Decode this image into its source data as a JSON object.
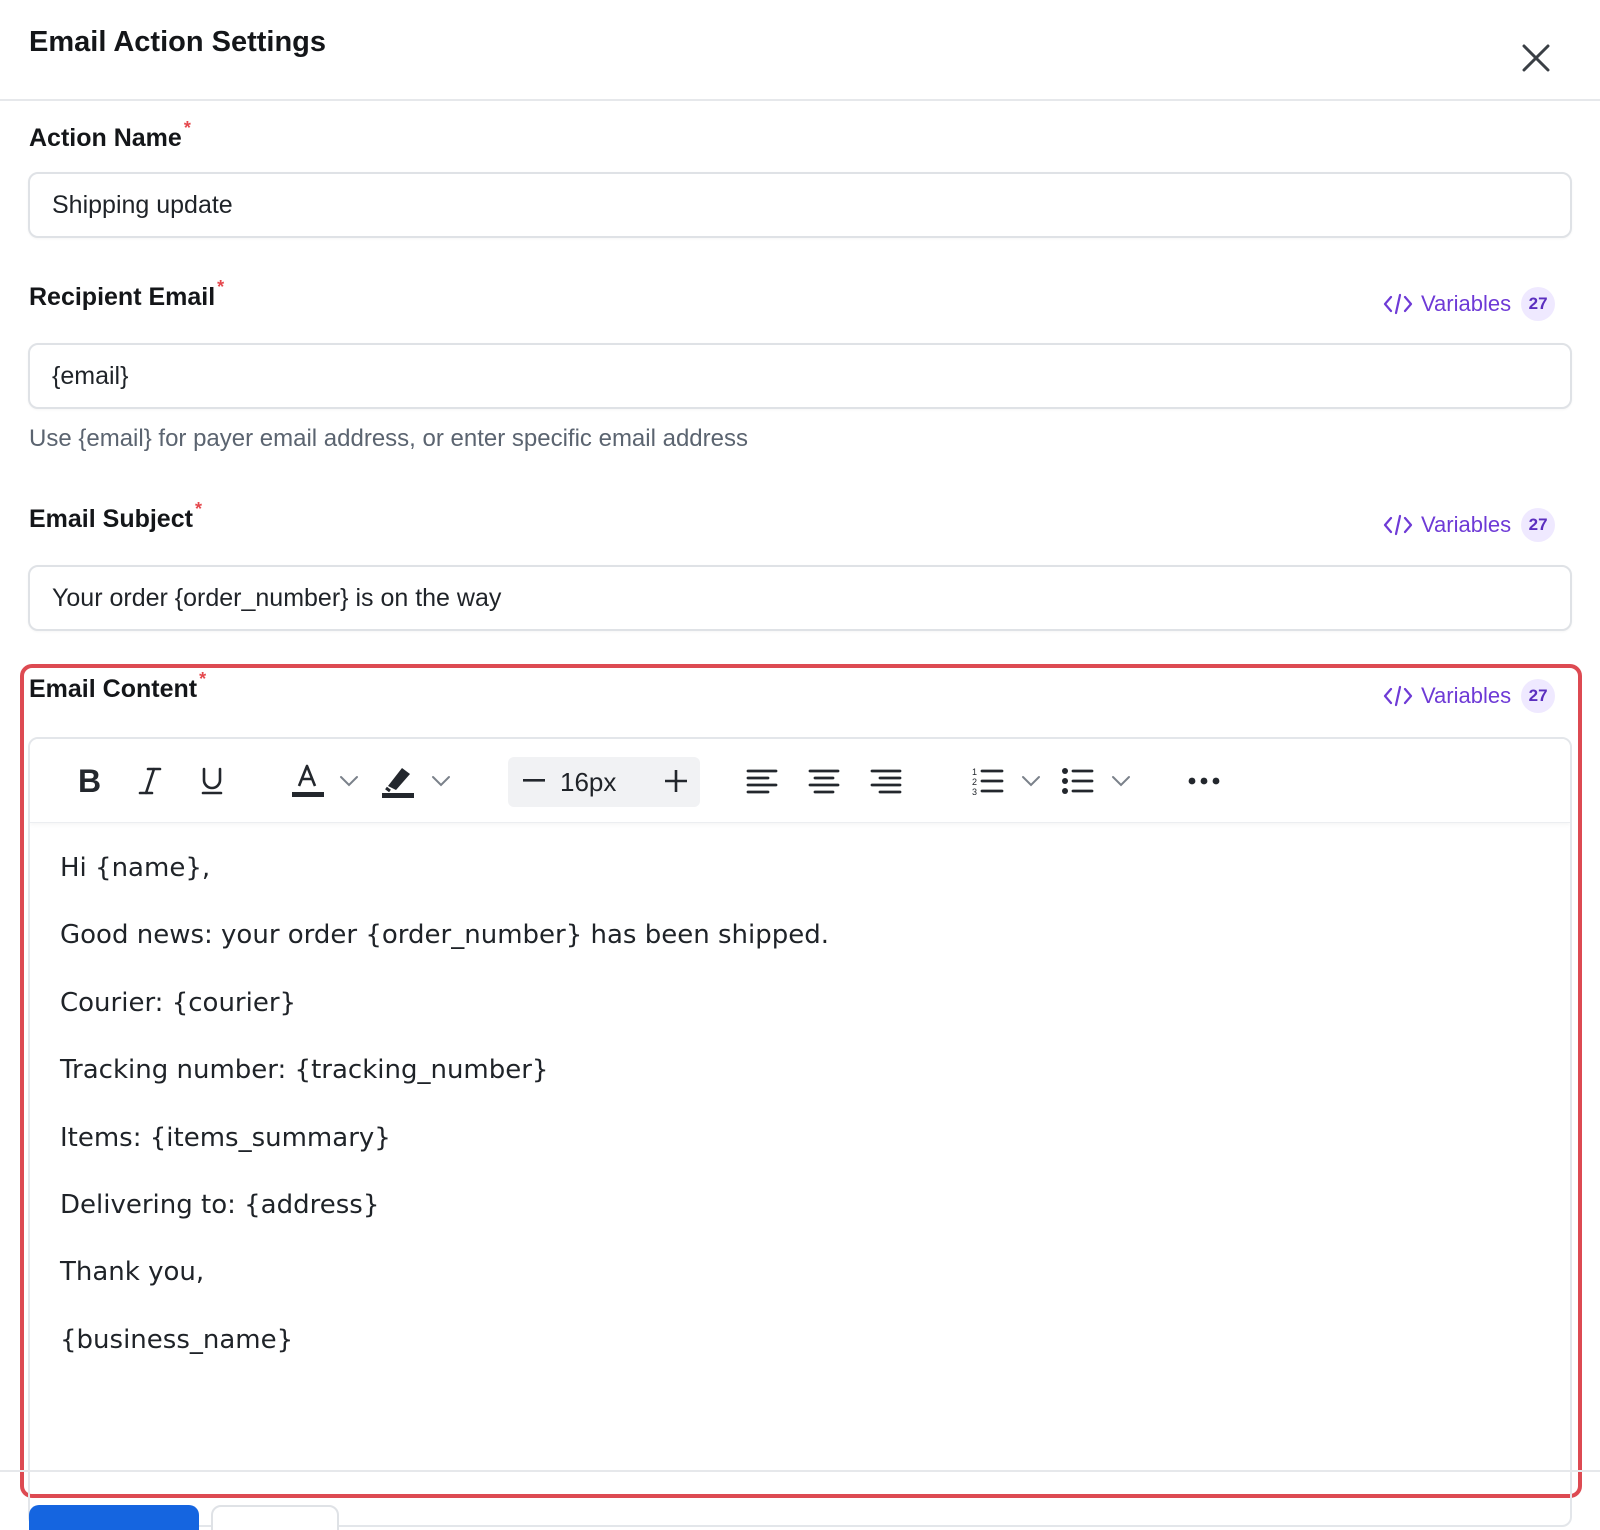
{
  "dialog": {
    "title": "Email Action Settings"
  },
  "fields": {
    "action_name": {
      "label": "Action Name",
      "required_mark": "*",
      "value": "Shipping update"
    },
    "recipient_email": {
      "label": "Recipient Email",
      "required_mark": "*",
      "value": "{email}",
      "help": "Use {email} for payer email address, or enter specific email address"
    },
    "email_subject": {
      "label": "Email Subject",
      "required_mark": "*",
      "value": "Your order {order_number} is on the way"
    },
    "email_content": {
      "label": "Email Content",
      "required_mark": "*"
    }
  },
  "variables": {
    "label": "Variables",
    "count": "27"
  },
  "toolbar": {
    "font_size": "16px",
    "icons": [
      "bold-icon",
      "italic-icon",
      "underline-icon",
      "text-color-icon",
      "highlight-icon",
      "decrease-font-icon",
      "increase-font-icon",
      "align-left-icon",
      "align-center-icon",
      "align-right-icon",
      "numbered-list-icon",
      "bullet-list-icon",
      "more-icon"
    ]
  },
  "content_lines": [
    "Hi {name},",
    "Good news: your order {order_number} has been shipped.",
    "Courier: {courier}",
    "Tracking number: {tracking_number}",
    "Items: {items_summary}",
    "Delivering to: {address}",
    "Thank you,",
    "{business_name}"
  ],
  "colors": {
    "accent_purple": "#6e3ad6",
    "required_red": "#e5484d",
    "highlight_border": "#dd4a52",
    "primary_button": "#1565e0"
  }
}
